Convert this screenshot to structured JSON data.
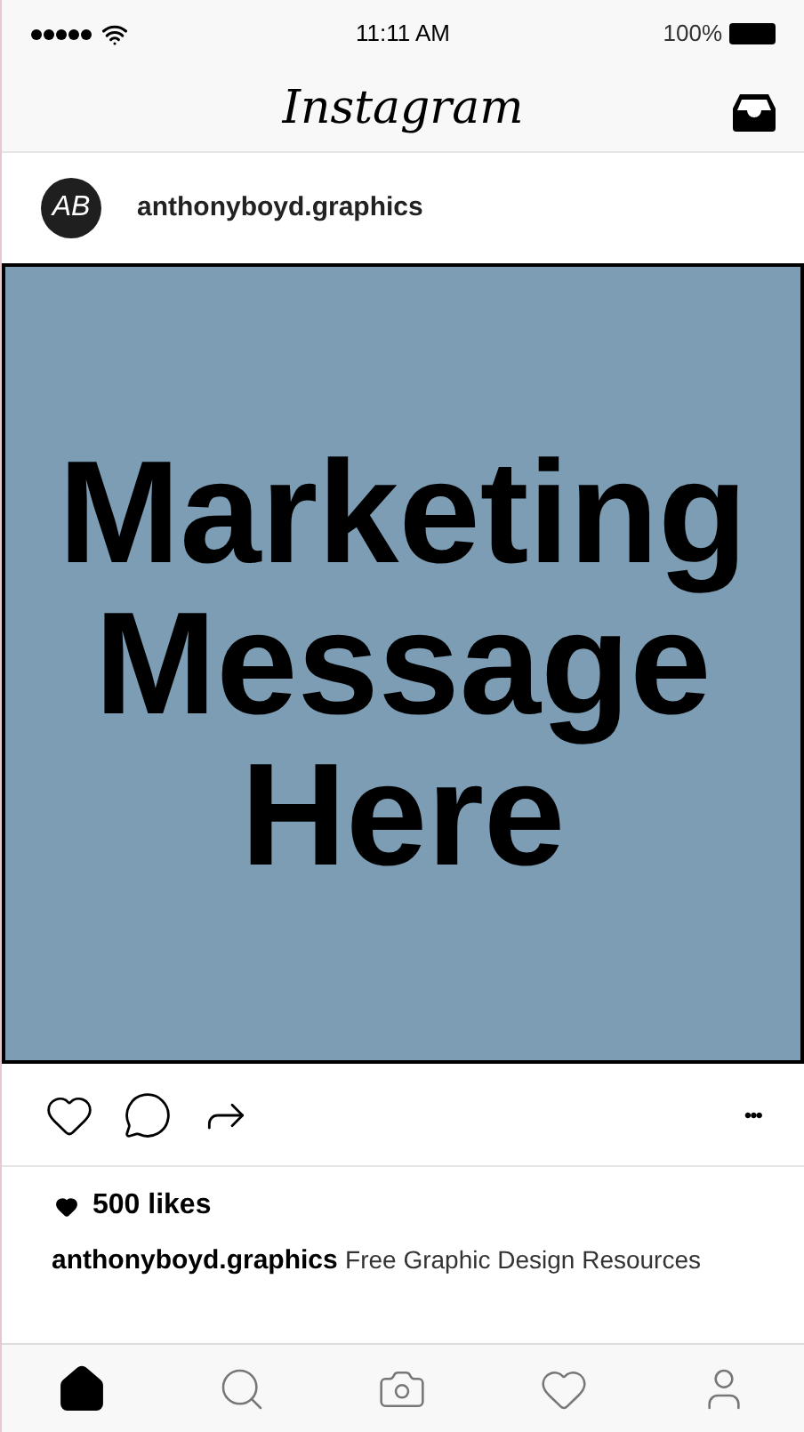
{
  "status_bar": {
    "time": "11:11 AM",
    "battery": "100%"
  },
  "header": {
    "title": "Instagram"
  },
  "post": {
    "avatar": "AB",
    "username": "anthonyboyd.graphics",
    "image_lines": [
      "Marketing",
      "Message",
      "Here"
    ],
    "more": "•••",
    "likes": "500 likes",
    "caption_user": "anthonyboyd.graphics",
    "caption": "Free Graphic Design Resources"
  },
  "tab_bar": [
    {
      "kind": "home",
      "selected": true
    },
    {
      "kind": "search",
      "selected": false
    },
    {
      "kind": "camera",
      "selected": false
    },
    {
      "kind": "activity",
      "selected": false
    },
    {
      "kind": "profile",
      "selected": false
    }
  ]
}
